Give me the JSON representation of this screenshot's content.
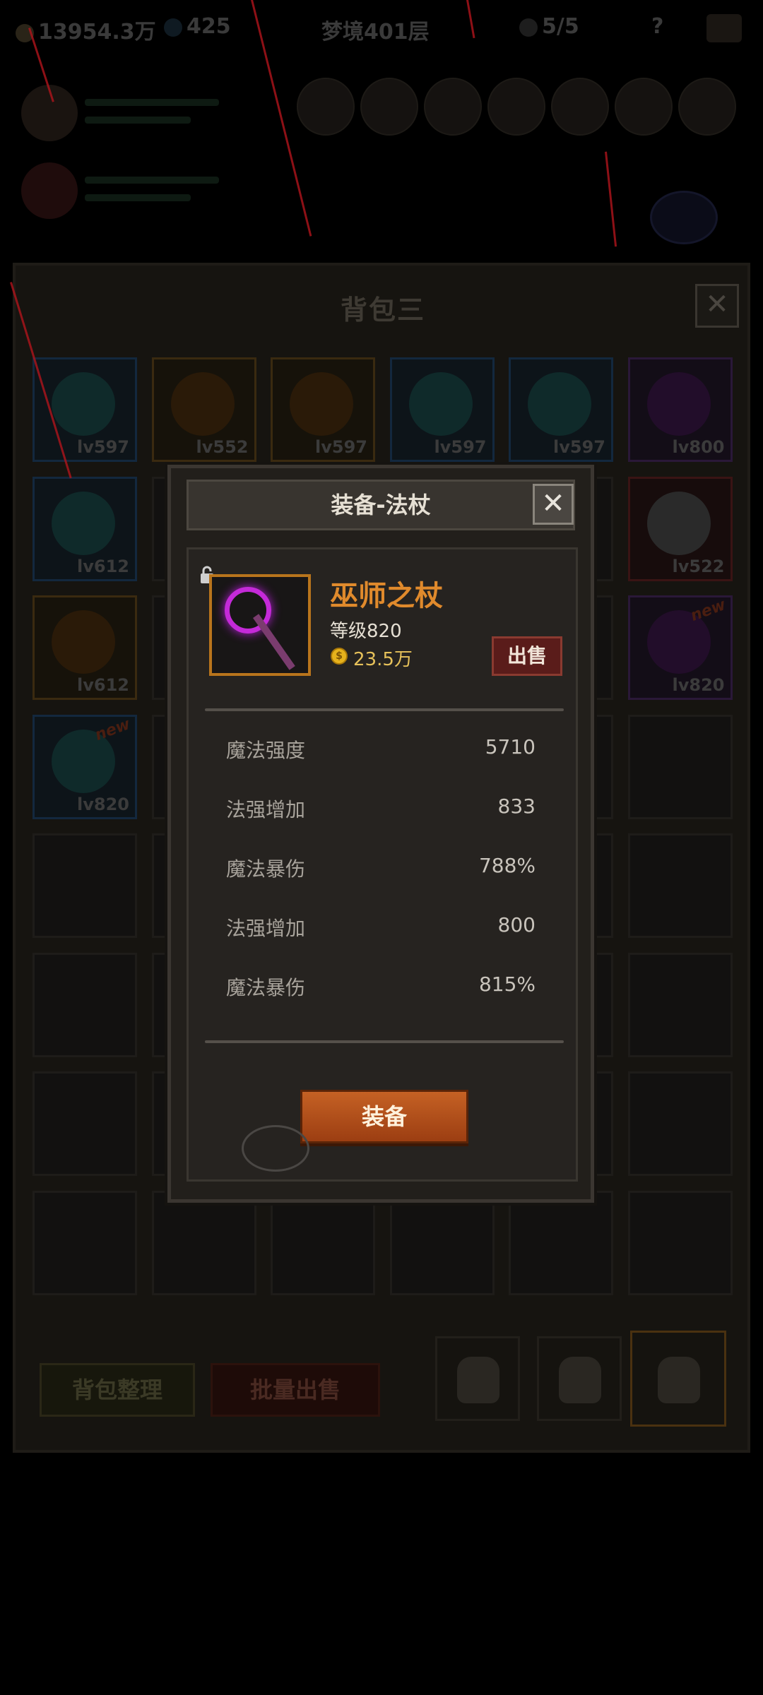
{
  "hud": {
    "gold": "13954.3万",
    "gems": "425",
    "stage": "梦境401层",
    "skulls": "5/5",
    "help": "?"
  },
  "bag": {
    "title": "背包三",
    "close": "✕",
    "slots": [
      {
        "lv": "lv597",
        "style": "blue",
        "new": ""
      },
      {
        "lv": "lv552",
        "style": "gold",
        "new": ""
      },
      {
        "lv": "lv597",
        "style": "gold",
        "new": ""
      },
      {
        "lv": "lv597",
        "style": "blue",
        "new": ""
      },
      {
        "lv": "lv597",
        "style": "blue",
        "new": ""
      },
      {
        "lv": "lv800",
        "style": "purple",
        "new": ""
      },
      {
        "lv": "lv612",
        "style": "blue",
        "new": ""
      },
      {
        "lv": "lv522",
        "style": "red",
        "new": ""
      },
      {
        "lv": "lv612",
        "style": "gold",
        "new": ""
      },
      {
        "lv": "lv820",
        "style": "purple",
        "new": "new"
      },
      {
        "lv": "lv820",
        "style": "blue",
        "new": "new"
      }
    ],
    "sort_button": "背包整理",
    "bulk_sell_button": "批量出售"
  },
  "modal": {
    "title": "装备-法杖",
    "close": "✕",
    "item_name": "巫师之杖",
    "item_level": "等级820",
    "coin_symbol": "$",
    "item_price": "23.5万",
    "sell_button": "出售",
    "stats": [
      {
        "label": "魔法强度",
        "value": "5710"
      },
      {
        "label": "法强增加",
        "value": "833"
      },
      {
        "label": "魔法暴伤",
        "value": "788%"
      },
      {
        "label": "法强增加",
        "value": "800"
      },
      {
        "label": "魔法暴伤",
        "value": "815%"
      }
    ],
    "equip_button": "装备"
  },
  "colors": {
    "item_name": "#e08a2c",
    "equip_button": "#c56124",
    "sell_button": "#5a1c1a",
    "frame_gold": "#b8741c"
  }
}
